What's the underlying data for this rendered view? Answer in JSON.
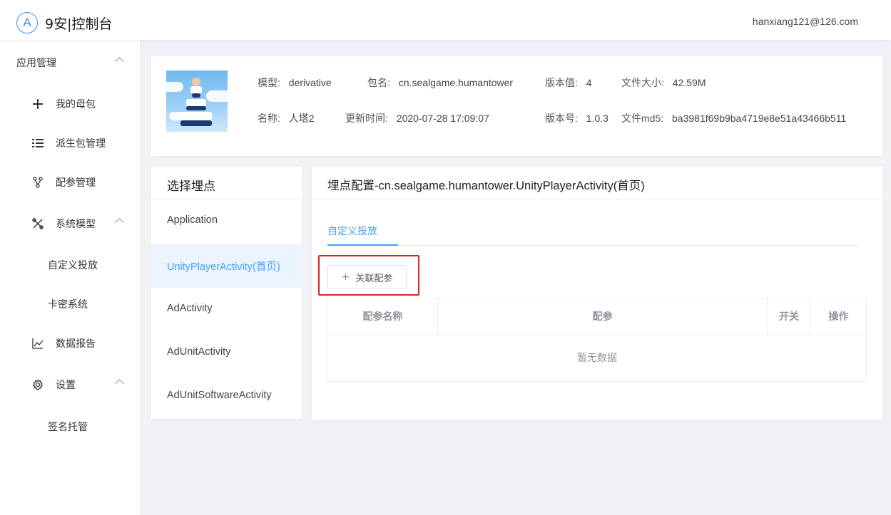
{
  "header": {
    "logo_letter": "A",
    "app_title": "9安|控制台",
    "user_email": "hanxiang121@126.com"
  },
  "sidebar": {
    "items": [
      {
        "label": "应用管理",
        "icon": "none",
        "level": "top"
      },
      {
        "label": "我的母包",
        "icon": "plus-icon",
        "level": "item"
      },
      {
        "label": "派生包管理",
        "icon": "list-icon",
        "level": "item"
      },
      {
        "label": "配参管理",
        "icon": "branch-icon",
        "level": "item"
      },
      {
        "label": "系统模型",
        "icon": "tools-icon",
        "level": "item"
      },
      {
        "label": "自定义投放",
        "icon": "none",
        "level": "sub"
      },
      {
        "label": "卡密系统",
        "icon": "none",
        "level": "sub"
      },
      {
        "label": "数据报告",
        "icon": "chart-icon",
        "level": "item"
      },
      {
        "label": "设置",
        "icon": "gear-icon",
        "level": "item"
      },
      {
        "label": "签名托管",
        "icon": "none",
        "level": "sub"
      }
    ]
  },
  "app_info": {
    "model_label": "模型:",
    "model_value": "derivative",
    "package_label": "包名:",
    "package_value": "cn.sealgame.humantower",
    "version_code_label": "版本值:",
    "version_code_value": "4",
    "file_size_label": "文件大小:",
    "file_size_value": "42.59M",
    "name_label": "名称:",
    "name_value": "人塔2",
    "update_time_label": "更新时间:",
    "update_time_value": "2020-07-28 17:09:07",
    "version_name_label": "版本号:",
    "version_name_value": "1.0.3",
    "md5_label": "文件md5:",
    "md5_value": "ba3981f69b9ba4719e8e51a43466b511"
  },
  "points_panel": {
    "title": "选择埋点",
    "items": [
      {
        "label": "Application",
        "active": false
      },
      {
        "label": "UnityPlayerActivity(首页)",
        "active": true
      },
      {
        "label": "AdActivity",
        "active": false
      },
      {
        "label": "AdUnitActivity",
        "active": false
      },
      {
        "label": "AdUnitSoftwareActivity",
        "active": false
      }
    ]
  },
  "config_panel": {
    "title": "埋点配置-cn.sealgame.humantower.UnityPlayerActivity(首页)",
    "tab_label": "自定义投放",
    "add_button_label": "关联配参",
    "table": {
      "headers": [
        "配参名称",
        "配参",
        "开关",
        "操作"
      ],
      "empty_text": "暂无数据"
    }
  },
  "colors": {
    "accent": "#409eff",
    "highlight": "#e02424",
    "active_bg": "#ecf5ff"
  }
}
